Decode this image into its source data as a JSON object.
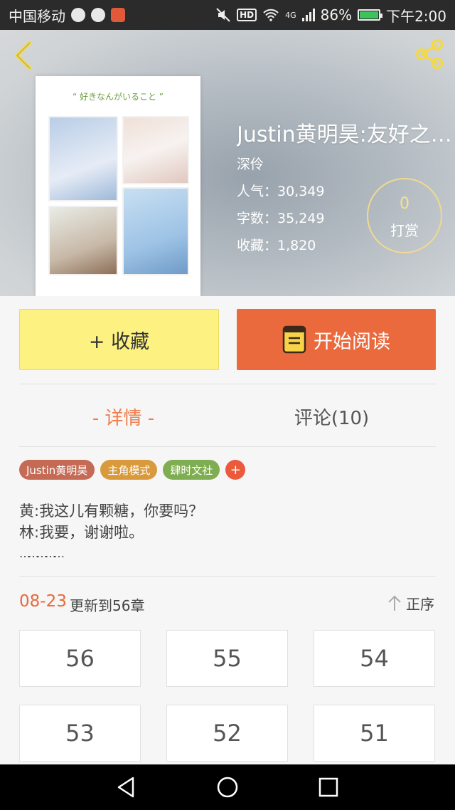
{
  "status_bar": {
    "carrier": "中国移动",
    "network": "4G",
    "battery": "86%",
    "time": "下午2:00",
    "hd_badge": "HD"
  },
  "book": {
    "title": "Justin黄明昊:友好之…",
    "author": "深伶",
    "cover_caption": "“ 好きなんがいること ”",
    "stats": {
      "popularity": "人气：30,349",
      "words": "字数：35,249",
      "favorites": "收藏：1,820"
    },
    "tip": {
      "count": "0",
      "label": "打赏"
    }
  },
  "actions": {
    "favorite_label": "+ 收藏",
    "read_label": "开始阅读"
  },
  "tabs": {
    "detail": "- 详情 -",
    "comments": "评论(10)"
  },
  "tags": [
    "Justin黄明昊",
    "主角模式",
    "肆时文社"
  ],
  "tag_add": "+",
  "synopsis": [
    "黄:我这儿有颗糖，你要吗？",
    "林:我要，谢谢啦。",
    "……………"
  ],
  "update": {
    "date": "08-23",
    "text": "更新到56章",
    "sort_label": "正序"
  },
  "chapters": [
    "56",
    "55",
    "54",
    "53",
    "52",
    "51"
  ],
  "colors": {
    "accent_orange": "#ea6a3d",
    "favorite_yellow": "#fdf281",
    "tab_active": "#ef7d4c"
  }
}
